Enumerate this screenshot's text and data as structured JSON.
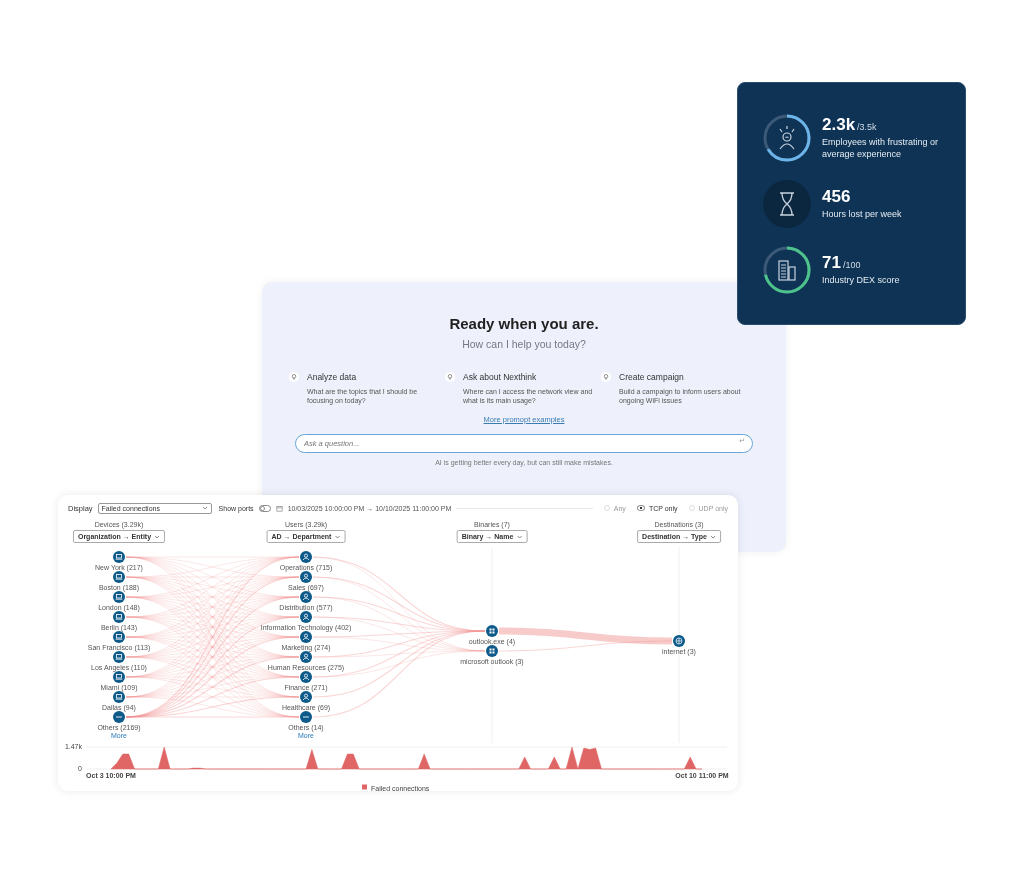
{
  "stats_card": {
    "items": [
      {
        "kind": "ring",
        "value": "2.3k",
        "total": "/3.5k",
        "label": "Employees with frustrating or average experience",
        "level": 0.66,
        "color": "#6cb4ea"
      },
      {
        "kind": "plain",
        "value": "456",
        "label": "Hours lost per week"
      },
      {
        "kind": "ring",
        "value": "71",
        "total": "/100",
        "label": "Industry DEX score",
        "level": 0.71,
        "color": "#4cc38a"
      }
    ]
  },
  "assistant": {
    "title": "Ready when you are.",
    "subtitle": "How can I help you today?",
    "suggestions": [
      {
        "title": "Analyze data",
        "text": "What are the topics that I should be focusing on today?"
      },
      {
        "title": "Ask about Nexthink",
        "text": "Where can I access the network view and what is its main usage?"
      },
      {
        "title": "Create campaign",
        "text": "Build a campaign to inform users about ongoing WiFi issues"
      }
    ],
    "link": "More promopt examples",
    "input": {
      "placeholder": "Ask a question...",
      "enter_key": "↵"
    },
    "disclaimer": "AI is getting better every day, but can still make mistakes."
  },
  "network": {
    "display_label": "Display",
    "display_select": "Failed connections",
    "show_ports": {
      "label": "Show ports",
      "on": false
    },
    "date_range": "10/03/2025 10:00:00 PM → 10/10/2025 11:00:00 PM",
    "protocols": [
      {
        "label": "Any",
        "selected": false,
        "disabled": true
      },
      {
        "label": "TCP only",
        "selected": true,
        "disabled": false
      },
      {
        "label": "UDP only",
        "selected": false,
        "disabled": true
      }
    ],
    "columns": [
      {
        "title": "Devices (3.29k)",
        "grouping": "Organization → Entity",
        "more": "More",
        "nodes": [
          {
            "label": "New York (217)",
            "kind": "device"
          },
          {
            "label": "Boston (188)",
            "kind": "device"
          },
          {
            "label": "London (148)",
            "kind": "device"
          },
          {
            "label": "Berlin (143)",
            "kind": "device"
          },
          {
            "label": "San Francisco (113)",
            "kind": "device"
          },
          {
            "label": "Los Angeles (110)",
            "kind": "device"
          },
          {
            "label": "Miami (109)",
            "kind": "device"
          },
          {
            "label": "Dallas (94)",
            "kind": "device"
          },
          {
            "label": "Others (2169)",
            "kind": "others"
          }
        ]
      },
      {
        "title": "Users (3.29k)",
        "grouping": "AD → Department",
        "more": "More",
        "nodes": [
          {
            "label": "Operations (715)",
            "kind": "user"
          },
          {
            "label": "Sales (697)",
            "kind": "user"
          },
          {
            "label": "Distribution (577)",
            "kind": "user"
          },
          {
            "label": "Information Technology (402)",
            "kind": "user"
          },
          {
            "label": "Marketing (274)",
            "kind": "user"
          },
          {
            "label": "Human Resources (275)",
            "kind": "user"
          },
          {
            "label": "Finance (271)",
            "kind": "user"
          },
          {
            "label": "Healthcare (69)",
            "kind": "user"
          },
          {
            "label": "Others (14)",
            "kind": "others"
          }
        ]
      },
      {
        "title": "Binaries (7)",
        "grouping": "Binary → Name",
        "nodes": [
          {
            "label": "outlook.exe (4)",
            "kind": "binary"
          },
          {
            "label": "microsoft outlook (3)",
            "kind": "binary"
          }
        ]
      },
      {
        "title": "Destinations (3)",
        "grouping": "Destination → Type",
        "nodes": [
          {
            "label": "internet (3)",
            "kind": "destination"
          }
        ]
      }
    ],
    "chart_data": {
      "type": "area",
      "categories": [
        "Oct 3 10:00 PM",
        null,
        null,
        null,
        null,
        null,
        null,
        null,
        null,
        null,
        null,
        null,
        null,
        null,
        null,
        null,
        null,
        null,
        null,
        null,
        null,
        null,
        null,
        null,
        null,
        null,
        null,
        null,
        null,
        null,
        null,
        null,
        null,
        null,
        null,
        null,
        null,
        null,
        null,
        null,
        null,
        null,
        null,
        null,
        null,
        null,
        null,
        null,
        null,
        null,
        null,
        null,
        null,
        null,
        null,
        null,
        null,
        null,
        null,
        null,
        null,
        null,
        null,
        null,
        null,
        null,
        null,
        null,
        null,
        null,
        null,
        null,
        null,
        null,
        null,
        null,
        null,
        null,
        null,
        null,
        null,
        null,
        null,
        null,
        null,
        null,
        null,
        null,
        null,
        null,
        null,
        null,
        null,
        null,
        null,
        null,
        null,
        null,
        null,
        null,
        "Oct 10 11:00 PM"
      ],
      "yticks": [
        0,
        {
          "value": 1470,
          "label": "1.47k"
        }
      ],
      "ylim": [
        0,
        1470
      ],
      "series": [
        {
          "name": "Failed connections",
          "color": "#e06666",
          "values": [
            0,
            400,
            1000,
            1000,
            0,
            0,
            0,
            0,
            0,
            1470,
            0,
            0,
            0,
            0,
            60,
            60,
            0,
            0,
            0,
            0,
            0,
            0,
            0,
            0,
            0,
            0,
            0,
            0,
            0,
            0,
            0,
            0,
            0,
            0,
            1300,
            0,
            0,
            0,
            0,
            0,
            1000,
            1000,
            0,
            0,
            0,
            0,
            0,
            0,
            0,
            0,
            0,
            0,
            0,
            1000,
            0,
            0,
            0,
            0,
            0,
            0,
            0,
            0,
            0,
            0,
            0,
            0,
            0,
            0,
            0,
            0,
            800,
            0,
            0,
            0,
            0,
            800,
            0,
            0,
            1470,
            0,
            1400,
            1300,
            1400,
            0,
            0,
            0,
            0,
            0,
            0,
            0,
            0,
            0,
            0,
            0,
            0,
            0,
            0,
            0,
            800,
            0,
            0
          ]
        }
      ]
    }
  }
}
